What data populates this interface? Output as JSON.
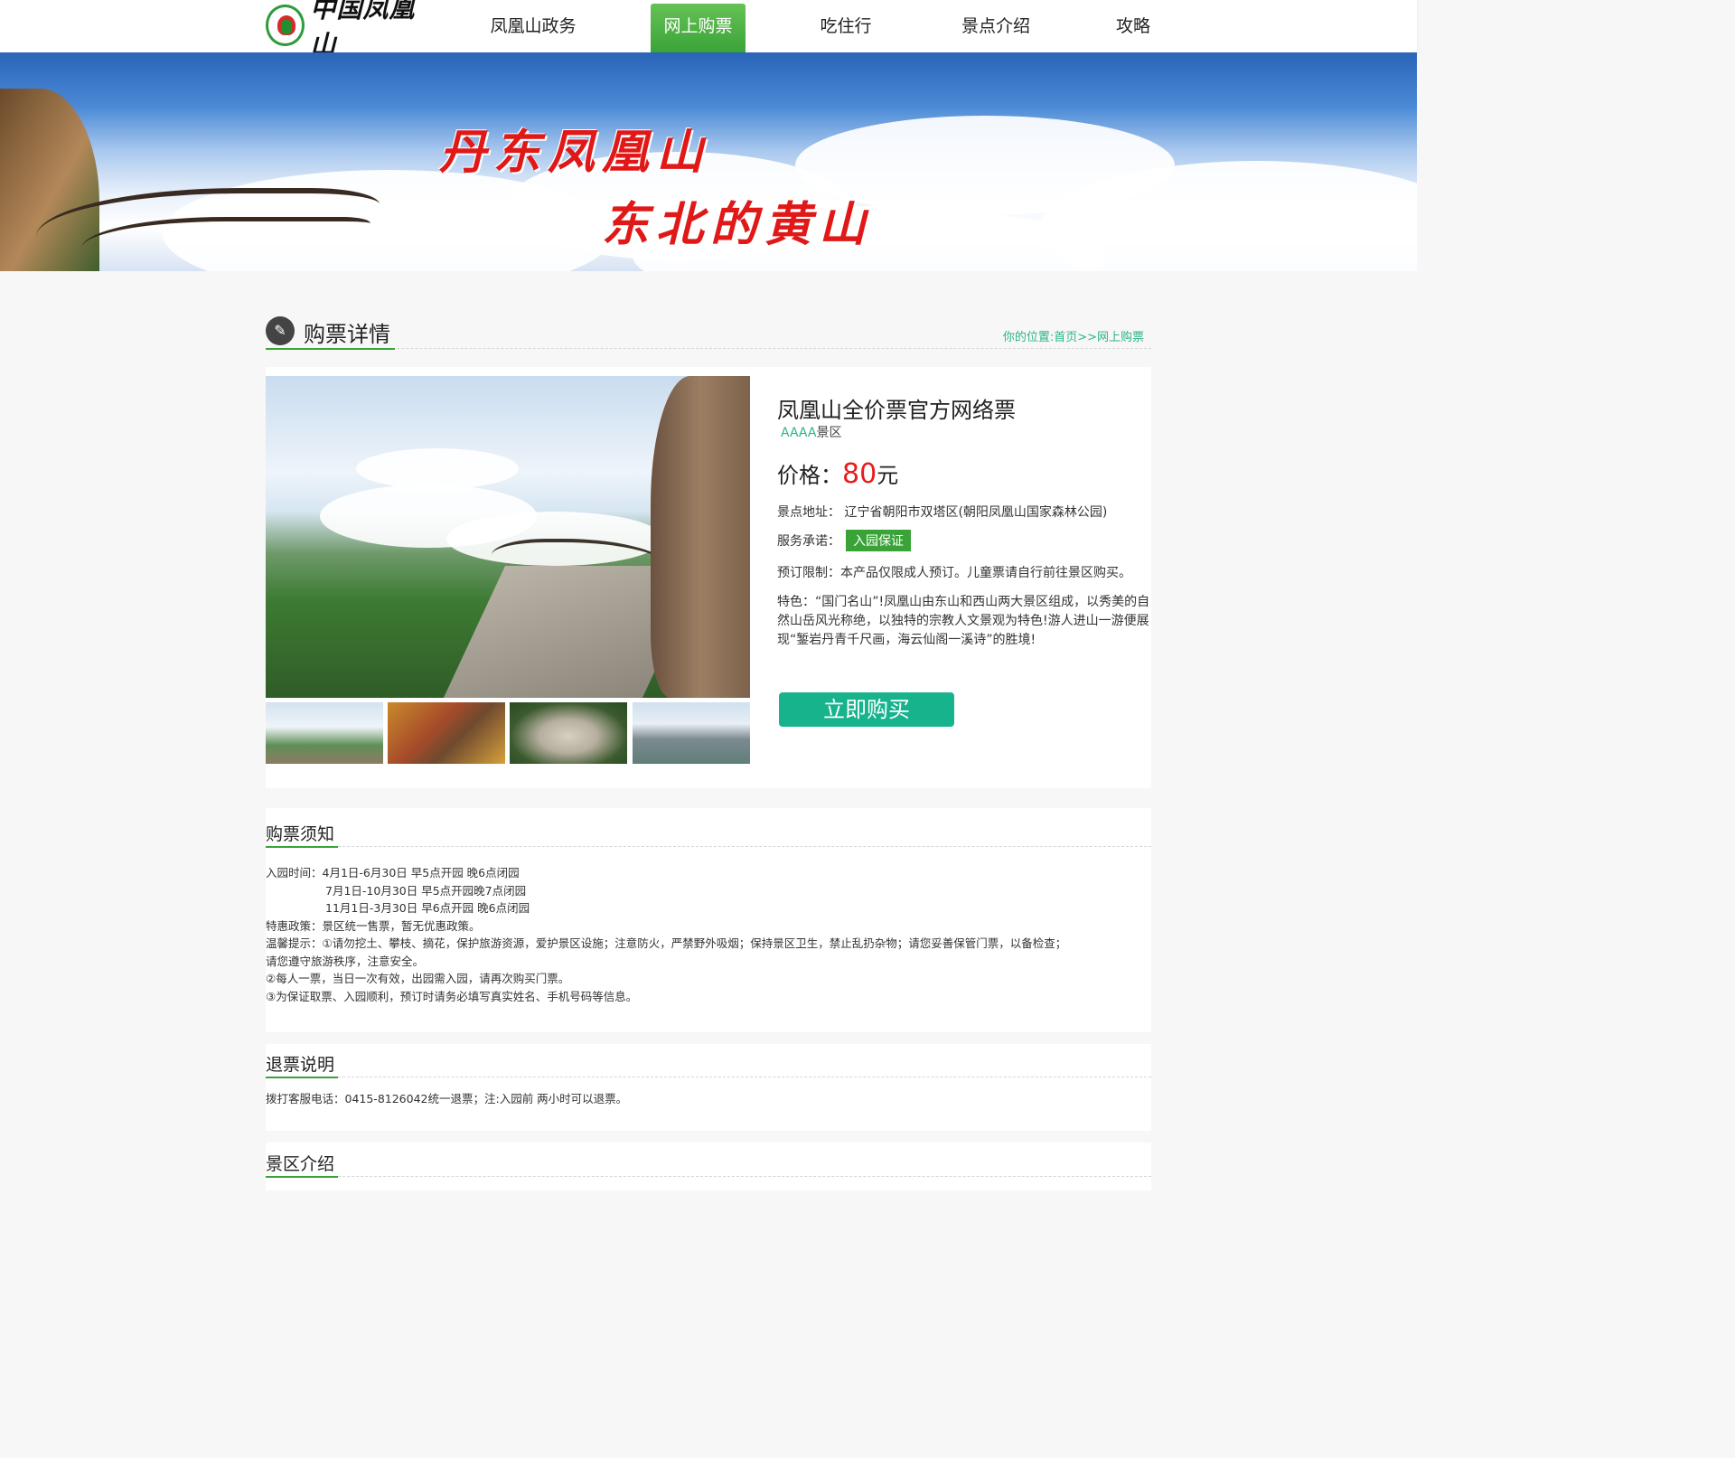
{
  "header": {
    "logo_text": "中国凤凰山",
    "nav": [
      {
        "label": "凤凰山政务",
        "active": false
      },
      {
        "label": "网上购票",
        "active": true
      },
      {
        "label": "吃住行",
        "active": false
      },
      {
        "label": "景点介绍",
        "active": false
      },
      {
        "label": "攻略",
        "active": false
      }
    ]
  },
  "banner": {
    "line1": "丹东凤凰山",
    "line2": "东北的黄山"
  },
  "section": {
    "title": "购票详情",
    "icon": "ticket-icon",
    "breadcrumb": "你的位置:首页>>网上购票"
  },
  "product": {
    "name": "凤凰山全价票官方网络票",
    "level_aaaa": "AAAA",
    "level_suffix": "景区",
    "price_label": "价格：",
    "price_value": "80",
    "price_unit": "元",
    "address_label": "景点地址：",
    "address_value": "辽宁省朝阳市双塔区(朝阳凤凰山国家森林公园)",
    "service_label": "服务承诺：",
    "service_badge": "入园保证",
    "restriction": "预订限制：本产品仅限成人预订。儿童票请自行前往景区购买。",
    "feature": "特色：“国门名山”!凤凰山由东山和西山两大景区组成，以秀美的自然山岳风光称绝，以独特的宗教人文景观为特色!游人进山一游便展现“錾岩丹青千尺画，海云仙阁一溪诗”的胜境!",
    "buy_button": "立即购买"
  },
  "notice": {
    "title": "购票须知",
    "lines": [
      "入园时间：4月1日-6月30日    早5点开园 晚6点闭园",
      "7月1日-10月30日  早5点开园晚7点闭园",
      "11月1日-3月30日  早6点开园 晚6点闭园",
      "特惠政策：景区统一售票，暂无优惠政策。",
      "温馨提示：①请勿挖土、攀枝、摘花，保护旅游资源，爱护景区设施；注意防火，严禁野外吸烟；保持景区卫生，禁止乱扔杂物；请您妥善保管门票，以备检查；",
      "请您遵守旅游秩序，注意安全。",
      "②每人一票，当日一次有效，出园需入园，请再次购买门票。",
      "③为保证取票、入园顺利，预订时请务必填写真实姓名、手机号码等信息。"
    ]
  },
  "refund": {
    "title": "退票说明",
    "text": "拨打客服电话：0415-8126042统一退票；注:入园前   两小时可以退票。"
  },
  "intro": {
    "title": "景区介绍"
  },
  "colors": {
    "accent_green": "#3aa338",
    "teal": "#16b38c",
    "price_red": "#e81c1c",
    "banner_red": "#e01818"
  }
}
